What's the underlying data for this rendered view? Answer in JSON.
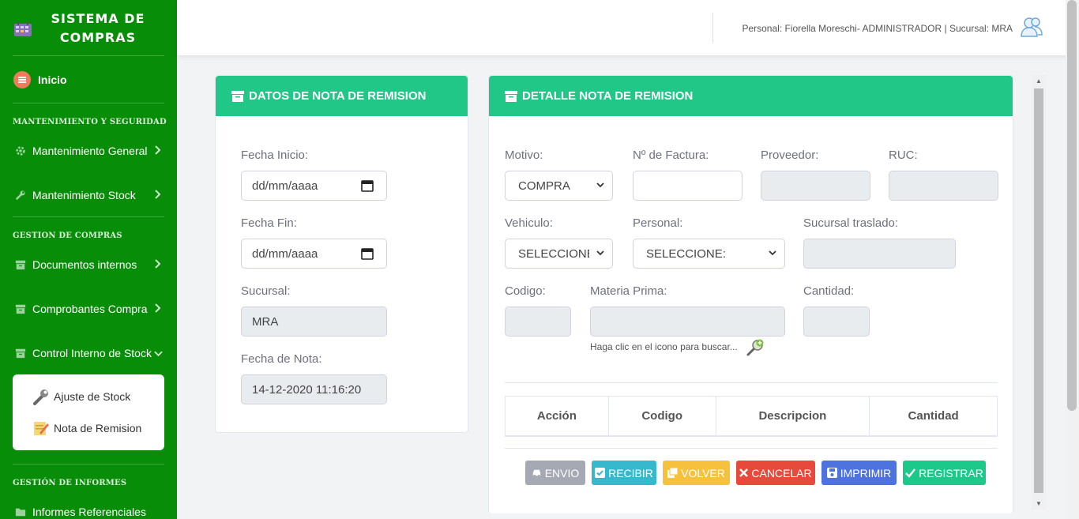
{
  "sidebar": {
    "brand_line1": "SISTEMA DE",
    "brand_line2": "COMPRAS",
    "inicio": "Inicio",
    "section1": "MANTENIMIENTO Y SEGURIDAD",
    "mant_general": "Mantenimiento General",
    "mant_stock": "Mantenimiento Stock",
    "section2": "GESTION DE COMPRAS",
    "docs_internos": "Documentos internos",
    "comprobantes": "Comprobantes Compra",
    "control_stock": "Control Interno de Stock",
    "sub_ajuste": "Ajuste de Stock",
    "sub_nota": "Nota de Remision",
    "section3": "GESTIÓN DE INFORMES",
    "informes": "Informes Referenciales",
    "colors": {
      "bg": "#078d07",
      "accent": "#20c787"
    }
  },
  "topbar": {
    "user_text": "Personal: Fiorella Moreschi- ADMINISTRADOR | Sucursal: MRA",
    "user_icon": "user-group-icon"
  },
  "datos": {
    "title": "DATOS DE NOTA DE REMISION",
    "fecha_inicio_label": "Fecha Inicio:",
    "fecha_inicio_value": "dd/mm/aaaa",
    "fecha_fin_label": "Fecha Fin:",
    "fecha_fin_value": "dd/mm/aaaa",
    "sucursal_label": "Sucursal:",
    "sucursal_value": "MRA",
    "fecha_nota_label": "Fecha de Nota:",
    "fecha_nota_value": "14-12-2020 11:16:20"
  },
  "detalle": {
    "title": "DETALLE NOTA DE REMISION",
    "motivo_label": "Motivo:",
    "motivo_value": "COMPRA",
    "factura_label": "Nº de Factura:",
    "proveedor_label": "Proveedor:",
    "ruc_label": "RUC:",
    "vehiculo_label": "Vehiculo:",
    "vehiculo_value": "SELECCIONE:",
    "personal_label": "Personal:",
    "personal_value": "SELECCIONE:",
    "sucursal_traslado_label": "Sucursal traslado:",
    "codigo_label": "Codigo:",
    "materia_label": "Materia Prima:",
    "cantidad_label": "Cantidad:",
    "hint": "Haga clic en el icono para buscar...",
    "table_headers": [
      "Acción",
      "Codigo",
      "Descripcion",
      "Cantidad"
    ]
  },
  "buttons": {
    "envio": "ENVIO",
    "recibir": "RECIBIR",
    "volver": "VOLVER",
    "cancelar": "CANCELAR",
    "imprimir": "IMPRIMIR",
    "registrar": "REGISTRAR",
    "colors": {
      "envio": "#a5a9b4",
      "recibir": "#36b9cc",
      "volver": "#f6c23e",
      "cancelar": "#e74a3b",
      "imprimir": "#4e73df",
      "registrar": "#1cc88a"
    }
  }
}
